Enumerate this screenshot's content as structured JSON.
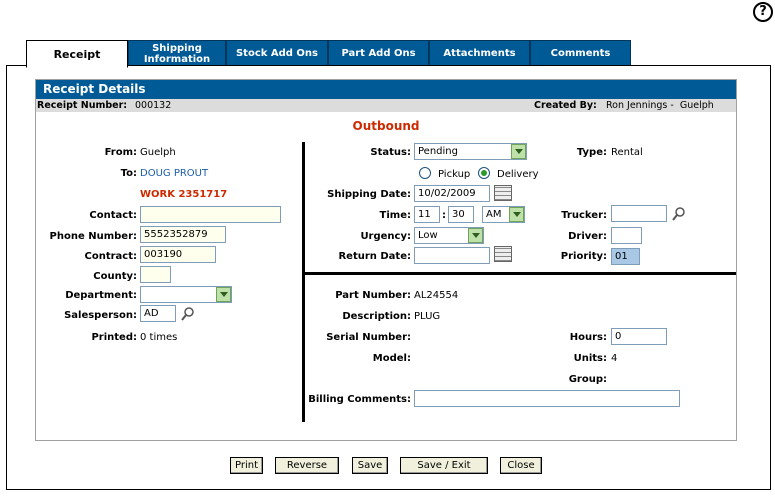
{
  "help": {
    "label": "?"
  },
  "tabs": [
    {
      "label": "Receipt"
    },
    {
      "label": "Shipping Information"
    },
    {
      "label": "Stock Add Ons"
    },
    {
      "label": "Part Add Ons"
    },
    {
      "label": "Attachments"
    },
    {
      "label": "Comments"
    }
  ],
  "section": {
    "title": "Receipt Details"
  },
  "info": {
    "receipt_number_label": "Receipt Number:",
    "receipt_number": "000132",
    "created_by_label": "Created By:",
    "created_by": "Ron Jennings -  Guelph"
  },
  "heading": "Outbound",
  "left": {
    "from_label": "From:",
    "from_value": "Guelph",
    "to_label": "To:",
    "to_value": "DOUG PROUT",
    "work_value": "WORK 2351717",
    "contact_label": "Contact:",
    "contact_value": "",
    "phone_label": "Phone Number:",
    "phone_value": "5552352879",
    "contract_label": "Contract:",
    "contract_value": "003190",
    "county_label": "County:",
    "county_value": "",
    "department_label": "Department:",
    "department_value": "",
    "salesperson_label": "Salesperson:",
    "salesperson_value": "AD",
    "printed_label": "Printed:",
    "printed_value": "0 times"
  },
  "right_top": {
    "status_label": "Status:",
    "status_value": "Pending",
    "type_label": "Type:",
    "type_value": "Rental",
    "pickup_label": "Pickup",
    "delivery_label": "Delivery",
    "shipping_date_label": "Shipping Date:",
    "shipping_date_value": "10/02/2009",
    "time_label": "Time:",
    "time_hour": "11",
    "time_sep": ":",
    "time_min": "30",
    "time_ampm": "AM",
    "trucker_label": "Trucker:",
    "trucker_value": "",
    "urgency_label": "Urgency:",
    "urgency_value": "Low",
    "driver_label": "Driver:",
    "driver_value": "",
    "return_date_label": "Return Date:",
    "return_date_value": "",
    "priority_label": "Priority:",
    "priority_value": "01"
  },
  "right_bottom": {
    "part_number_label": "Part Number:",
    "part_number_value": "AL24554",
    "description_label": "Description:",
    "description_value": "PLUG",
    "serial_label": "Serial Number:",
    "serial_value": "",
    "hours_label": "Hours:",
    "hours_value": "0",
    "model_label": "Model:",
    "model_value": "",
    "units_label": "Units:",
    "units_value": "4",
    "group_label": "Group:",
    "group_value": "",
    "billing_label": "Billing Comments:",
    "billing_value": ""
  },
  "buttons": {
    "print": "Print",
    "reverse": "Reverse",
    "save": "Save",
    "save_exit": "Save / Exit",
    "close": "Close"
  }
}
